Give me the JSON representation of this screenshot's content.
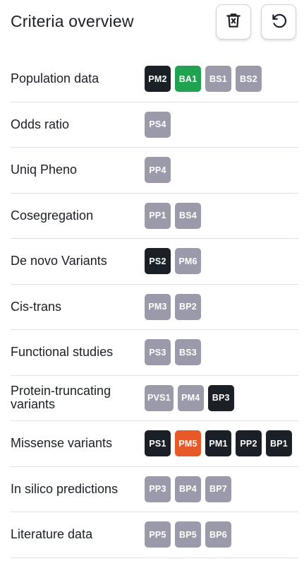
{
  "header": {
    "title": "Criteria overview"
  },
  "colors": {
    "inactive": "#9a9aab",
    "active": "#1b1f26",
    "green": "#20a250",
    "orange": "#e8592a"
  },
  "icons": {
    "delete": "trash-x-icon",
    "reset": "undo-arrow-icon"
  },
  "rows": [
    {
      "label": "Population data",
      "badges": [
        {
          "text": "PM2",
          "state": "active"
        },
        {
          "text": "BA1",
          "state": "green"
        },
        {
          "text": "BS1",
          "state": "inactive"
        },
        {
          "text": "BS2",
          "state": "inactive"
        }
      ]
    },
    {
      "label": "Odds ratio",
      "badges": [
        {
          "text": "PS4",
          "state": "inactive"
        }
      ]
    },
    {
      "label": "Uniq Pheno",
      "badges": [
        {
          "text": "PP4",
          "state": "inactive"
        }
      ]
    },
    {
      "label": "Cosegregation",
      "badges": [
        {
          "text": "PP1",
          "state": "inactive"
        },
        {
          "text": "BS4",
          "state": "inactive"
        }
      ]
    },
    {
      "label": "De novo Variants",
      "badges": [
        {
          "text": "PS2",
          "state": "active"
        },
        {
          "text": "PM6",
          "state": "inactive"
        }
      ]
    },
    {
      "label": "Cis-trans",
      "badges": [
        {
          "text": "PM3",
          "state": "inactive"
        },
        {
          "text": "BP2",
          "state": "inactive"
        }
      ]
    },
    {
      "label": "Functional studies",
      "badges": [
        {
          "text": "PS3",
          "state": "inactive"
        },
        {
          "text": "BS3",
          "state": "inactive"
        }
      ]
    },
    {
      "label": "Protein-truncating variants",
      "badges": [
        {
          "text": "PVS1",
          "state": "inactive"
        },
        {
          "text": "PM4",
          "state": "inactive"
        },
        {
          "text": "BP3",
          "state": "active"
        }
      ]
    },
    {
      "label": "Missense variants",
      "badges": [
        {
          "text": "PS1",
          "state": "active"
        },
        {
          "text": "PM5",
          "state": "orange"
        },
        {
          "text": "PM1",
          "state": "active"
        },
        {
          "text": "PP2",
          "state": "active"
        },
        {
          "text": "BP1",
          "state": "active"
        }
      ]
    },
    {
      "label": "In silico predictions",
      "badges": [
        {
          "text": "PP3",
          "state": "inactive"
        },
        {
          "text": "BP4",
          "state": "inactive"
        },
        {
          "text": "BP7",
          "state": "inactive"
        }
      ]
    },
    {
      "label": "Literature data",
      "badges": [
        {
          "text": "PP5",
          "state": "inactive"
        },
        {
          "text": "BP5",
          "state": "inactive"
        },
        {
          "text": "BP6",
          "state": "inactive"
        }
      ]
    }
  ]
}
